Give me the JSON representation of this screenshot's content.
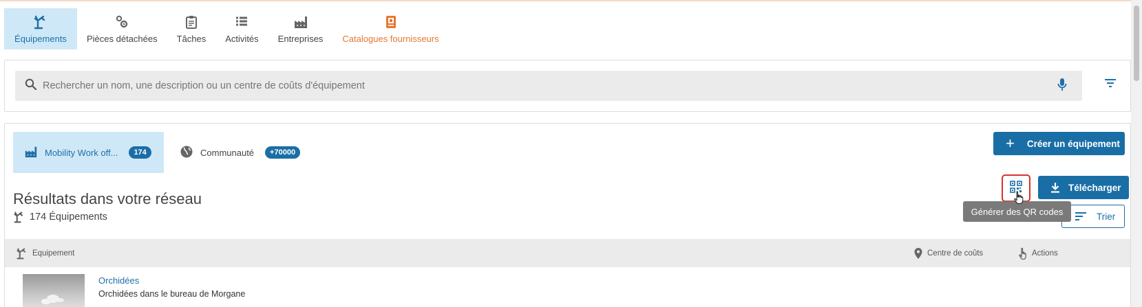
{
  "nav": {
    "items": [
      {
        "label": "Équipements",
        "icon": "equipment-icon"
      },
      {
        "label": "Pièces détachées",
        "icon": "gears-icon"
      },
      {
        "label": "Tâches",
        "icon": "clipboard-icon"
      },
      {
        "label": "Activités",
        "icon": "list-icon"
      },
      {
        "label": "Entreprises",
        "icon": "factory-icon"
      },
      {
        "label": "Catalogues fournisseurs",
        "icon": "catalog-icon"
      }
    ],
    "active_color": "#1f6fa8",
    "accent_orange": "#e8772e"
  },
  "search": {
    "placeholder": "Rechercher un nom, une description ou un centre de coûts d'équipement"
  },
  "tabs": {
    "network": {
      "label": "Mobility Work off...",
      "count": "174"
    },
    "community": {
      "label": "Communauté",
      "count": "+70000"
    }
  },
  "actions": {
    "create_label": "Créer un équipement",
    "download_label": "Télécharger",
    "sort_label": "Trier",
    "qr_tooltip": "Générer des QR codes",
    "primary_color": "#1a6ea6"
  },
  "results": {
    "title": "Résultats dans votre réseau",
    "count_text": "174 Équipements"
  },
  "table": {
    "headers": {
      "equipment": "Equipement",
      "cost_center": "Centre de coûts",
      "actions": "Actions"
    },
    "rows": [
      {
        "name": "Orchidées",
        "description": "Orchidées dans le bureau de Morgane"
      }
    ]
  }
}
